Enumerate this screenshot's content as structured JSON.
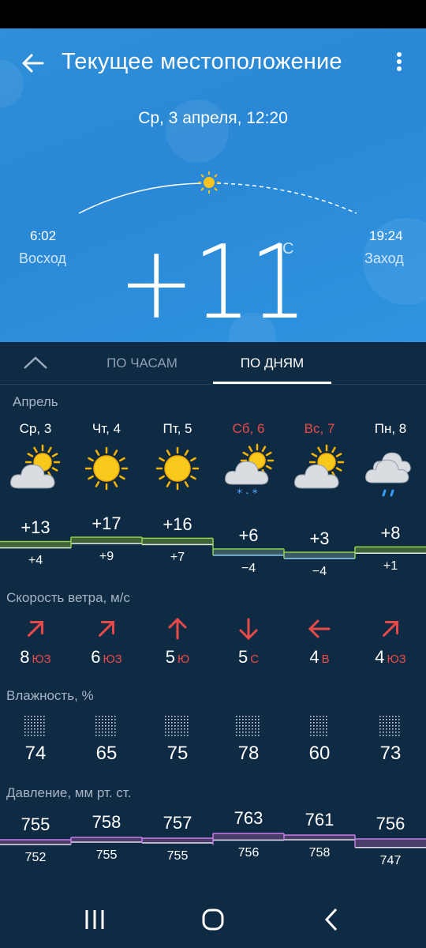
{
  "header": {
    "title": "Текущее местоположение",
    "datetime": "Ср, 3 апреля, 12:20"
  },
  "current": {
    "temperature": "+11",
    "unit": "°C",
    "sunrise_time": "6:02",
    "sunrise_label": "Восход",
    "sunset_time": "19:24",
    "sunset_label": "Заход"
  },
  "tabs": {
    "hourly": "ПО ЧАСАМ",
    "daily": "ПО ДНЯМ",
    "active": "daily"
  },
  "month": "Апрель",
  "days": [
    {
      "name": "Ср, 3",
      "weekend": false,
      "icon": "partly-cloudy-icon",
      "high": "+13",
      "low": "+4",
      "wind_speed": "8",
      "wind_dir": "ЮЗ",
      "wind_icon": "arrow-northeast-icon",
      "humidity": "74",
      "pressure_high": "755",
      "pressure_low": "752"
    },
    {
      "name": "Чт, 4",
      "weekend": false,
      "icon": "sunny-icon",
      "high": "+17",
      "low": "+9",
      "wind_speed": "6",
      "wind_dir": "ЮЗ",
      "wind_icon": "arrow-northeast-icon",
      "humidity": "65",
      "pressure_high": "758",
      "pressure_low": "755"
    },
    {
      "name": "Пт, 5",
      "weekend": false,
      "icon": "sunny-icon",
      "high": "+16",
      "low": "+7",
      "wind_speed": "5",
      "wind_dir": "Ю",
      "wind_icon": "arrow-up-icon",
      "humidity": "75",
      "pressure_high": "757",
      "pressure_low": "755"
    },
    {
      "name": "Сб, 6",
      "weekend": true,
      "icon": "partly-cloudy-rain-snow-icon",
      "high": "+6",
      "low": "−4",
      "wind_speed": "5",
      "wind_dir": "С",
      "wind_icon": "arrow-down-icon",
      "humidity": "78",
      "pressure_high": "763",
      "pressure_low": "756"
    },
    {
      "name": "Вс, 7",
      "weekend": true,
      "icon": "partly-cloudy-icon",
      "high": "+3",
      "low": "−4",
      "wind_speed": "4",
      "wind_dir": "В",
      "wind_icon": "arrow-left-icon",
      "humidity": "60",
      "pressure_high": "761",
      "pressure_low": "758"
    },
    {
      "name": "Пн, 8",
      "weekend": false,
      "icon": "cloudy-rain-icon",
      "high": "+8",
      "low": "+1",
      "wind_speed": "4",
      "wind_dir": "ЮЗ",
      "wind_icon": "arrow-northeast-icon",
      "humidity": "73",
      "pressure_high": "756",
      "pressure_low": "747"
    }
  ],
  "sections": {
    "wind": "Скорость ветра, м/с",
    "humidity": "Влажность, %",
    "pressure": "Давление, мм рт. ст."
  },
  "colors": {
    "hero_bg": "#2e8fdc",
    "panel_bg": "#0f2b44",
    "weekend": "#e84a4a",
    "temp_positive_line": "#8fcf4a",
    "temp_negative_line": "#8fd3f5",
    "pressure_line": "#c77de8",
    "wind_arrow": "#e84a4a"
  },
  "navigation": {
    "recent_icon": "recent-apps-icon",
    "home_icon": "home-icon",
    "back_icon": "back-icon"
  }
}
